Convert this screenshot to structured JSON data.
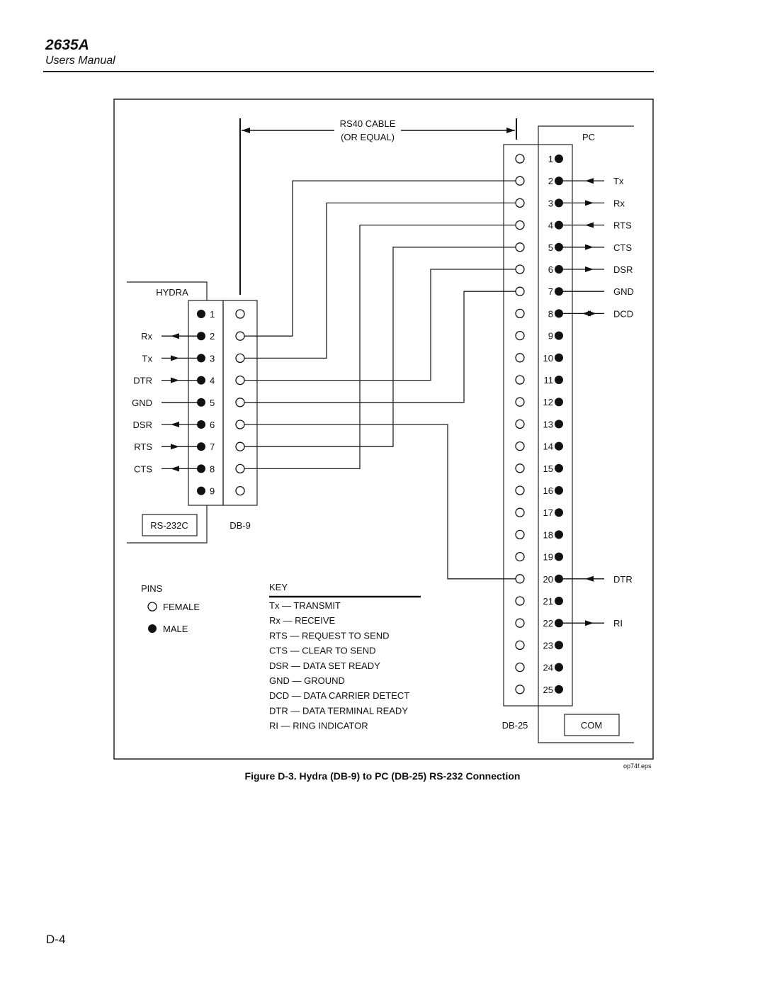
{
  "header": {
    "title": "2635A",
    "subtitle": "Users Manual"
  },
  "diagram": {
    "cable_label_line1": "RS40 CABLE",
    "cable_label_line2": "(OR EQUAL)",
    "hydra": {
      "label": "HYDRA",
      "interface_label": "RS-232C",
      "connector_label": "DB-9",
      "pins": [
        {
          "pin": "1",
          "signal": "",
          "direction": "none"
        },
        {
          "pin": "2",
          "signal": "Rx",
          "direction": "out"
        },
        {
          "pin": "3",
          "signal": "Tx",
          "direction": "in"
        },
        {
          "pin": "4",
          "signal": "DTR",
          "direction": "in"
        },
        {
          "pin": "5",
          "signal": "GND",
          "direction": "plain"
        },
        {
          "pin": "6",
          "signal": "DSR",
          "direction": "out"
        },
        {
          "pin": "7",
          "signal": "RTS",
          "direction": "in"
        },
        {
          "pin": "8",
          "signal": "CTS",
          "direction": "out"
        },
        {
          "pin": "9",
          "signal": "",
          "direction": "none"
        }
      ]
    },
    "pc": {
      "label": "PC",
      "interface_label": "COM",
      "connector_label": "DB-25",
      "pins": [
        {
          "pin": "1",
          "signal": "",
          "direction": "none"
        },
        {
          "pin": "2",
          "signal": "Tx",
          "direction": "in"
        },
        {
          "pin": "3",
          "signal": "Rx",
          "direction": "out"
        },
        {
          "pin": "4",
          "signal": "RTS",
          "direction": "in"
        },
        {
          "pin": "5",
          "signal": "CTS",
          "direction": "out"
        },
        {
          "pin": "6",
          "signal": "DSR",
          "direction": "out"
        },
        {
          "pin": "7",
          "signal": "GND",
          "direction": "plain"
        },
        {
          "pin": "8",
          "signal": "DCD",
          "direction": "both"
        },
        {
          "pin": "9",
          "signal": "",
          "direction": "none"
        },
        {
          "pin": "10",
          "signal": "",
          "direction": "none"
        },
        {
          "pin": "11",
          "signal": "",
          "direction": "none"
        },
        {
          "pin": "12",
          "signal": "",
          "direction": "none"
        },
        {
          "pin": "13",
          "signal": "",
          "direction": "none"
        },
        {
          "pin": "14",
          "signal": "",
          "direction": "none"
        },
        {
          "pin": "15",
          "signal": "",
          "direction": "none"
        },
        {
          "pin": "16",
          "signal": "",
          "direction": "none"
        },
        {
          "pin": "17",
          "signal": "",
          "direction": "none"
        },
        {
          "pin": "18",
          "signal": "",
          "direction": "none"
        },
        {
          "pin": "19",
          "signal": "",
          "direction": "none"
        },
        {
          "pin": "20",
          "signal": "DTR",
          "direction": "in"
        },
        {
          "pin": "21",
          "signal": "",
          "direction": "none"
        },
        {
          "pin": "22",
          "signal": "RI",
          "direction": "out"
        },
        {
          "pin": "23",
          "signal": "",
          "direction": "none"
        },
        {
          "pin": "24",
          "signal": "",
          "direction": "none"
        },
        {
          "pin": "25",
          "signal": "",
          "direction": "none"
        }
      ]
    },
    "wiring": [
      {
        "db9": 2,
        "db25": 2
      },
      {
        "db9": 3,
        "db25": 3
      },
      {
        "db9": 4,
        "db25": 6
      },
      {
        "db9": 5,
        "db25": 7
      },
      {
        "db9": 6,
        "db25": 20
      },
      {
        "db9": 7,
        "db25": 5
      },
      {
        "db9": 8,
        "db25": 4
      }
    ],
    "pins_legend": {
      "title": "PINS",
      "female": "FEMALE",
      "male": "MALE"
    },
    "key": {
      "title": "KEY",
      "entries": [
        "Tx — TRANSMIT",
        "Rx — RECEIVE",
        "RTS — REQUEST TO SEND",
        "CTS — CLEAR TO SEND",
        "DSR — DATA SET READY",
        "GND — GROUND",
        "DCD — DATA CARRIER DETECT",
        "DTR — DATA TERMINAL READY",
        "RI — RING INDICATOR"
      ]
    },
    "file_tag": "op74f.eps"
  },
  "caption": "Figure D-3. Hydra (DB-9) to PC (DB-25) RS-232 Connection",
  "page_number": "D-4"
}
